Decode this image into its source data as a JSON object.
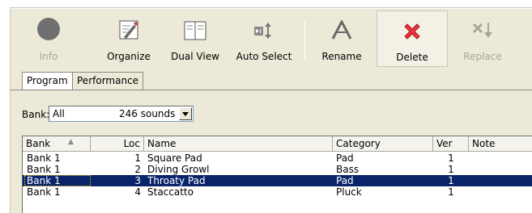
{
  "toolbar": {
    "info_label": "Info",
    "organize_label": "Organize",
    "dual_view_label": "Dual View",
    "auto_select_label": "Auto Select",
    "rename_label": "Rename",
    "delete_label": "Delete",
    "replace_label": "Replace",
    "colors": {
      "info": "#707070",
      "delete": "#e8323c",
      "disabled": "#a7a69d"
    }
  },
  "tabs": [
    {
      "label": "Program",
      "active": true
    },
    {
      "label": "Performance",
      "active": false
    }
  ],
  "bank": {
    "label": "Bank:",
    "value": "All",
    "count": "246 sounds"
  },
  "table": {
    "headers": [
      "Bank",
      "Loc",
      "Name",
      "Category",
      "Ver",
      "Note"
    ],
    "sort_icon": "sort-ascending-icon",
    "rows": [
      {
        "bank": "Bank 1",
        "loc": "1",
        "name": "Square Pad",
        "category": "Pad",
        "ver": "1",
        "note": ""
      },
      {
        "bank": "Bank 1",
        "loc": "2",
        "name": "Diving Growl",
        "category": "Bass",
        "ver": "1",
        "note": ""
      },
      {
        "bank": "Bank 1",
        "loc": "3",
        "name": "Throaty Pad",
        "category": "Pad",
        "ver": "1",
        "note": "",
        "selected": true
      },
      {
        "bank": "Bank 1",
        "loc": "4",
        "name": "Staccatto",
        "category": "Pluck",
        "ver": "1",
        "note": ""
      }
    ],
    "selection_color": "#0a246a"
  }
}
